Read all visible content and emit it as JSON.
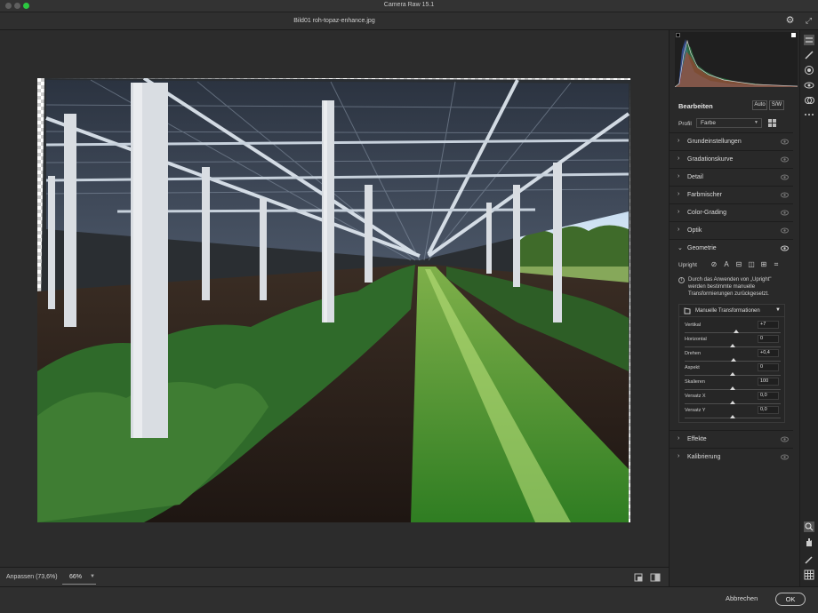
{
  "window": {
    "app_title": "Camera Raw 15.1",
    "file_name": "Bild01 roh-topaz-enhance.jpg"
  },
  "header": {
    "settings_icon": "gear-icon",
    "fullscreen_icon": "expand-icon"
  },
  "status": {
    "fit_label": "Anpassen (73,6%)",
    "zoom_value": "66%"
  },
  "footer": {
    "cancel_label": "Abbrechen",
    "ok_label": "OK"
  },
  "panel": {
    "title": "Bearbeiten",
    "auto_label": "Auto",
    "sw_label": "S/W",
    "profile_label": "Profil",
    "profile_value": "Farbe",
    "sections": [
      {
        "label": "Grundeinstellungen",
        "expanded": false
      },
      {
        "label": "Gradationskurve",
        "expanded": false
      },
      {
        "label": "Detail",
        "expanded": false
      },
      {
        "label": "Farbmischer",
        "expanded": false
      },
      {
        "label": "Color-Grading",
        "expanded": false
      },
      {
        "label": "Optik",
        "expanded": false
      },
      {
        "label": "Geometrie",
        "expanded": true
      },
      {
        "label": "Effekte",
        "expanded": false
      },
      {
        "label": "Kalibrierung",
        "expanded": false
      }
    ],
    "geometry": {
      "upright_label": "Upright",
      "info_text": "Durch das Anwenden von „Upright\" werden bestimmte manuelle Transformierungen zurückgesetzt.",
      "manual_title": "Manuelle Transformationen",
      "sliders": [
        {
          "label": "Vertikal",
          "value": "+7",
          "fraction": 0.535
        },
        {
          "label": "Horizontal",
          "value": "0",
          "fraction": 0.5
        },
        {
          "label": "Drehen",
          "value": "+0,4",
          "fraction": 0.505
        },
        {
          "label": "Aspekt",
          "value": "0",
          "fraction": 0.5
        },
        {
          "label": "Skalieren",
          "value": "100",
          "fraction": 0.5
        },
        {
          "label": "Versatz X",
          "value": "0,0",
          "fraction": 0.5
        },
        {
          "label": "Versatz Y",
          "value": "0,0",
          "fraction": 0.5
        }
      ]
    }
  },
  "colors": {
    "accent": "#2bc840",
    "histogram_red": "#c0392b",
    "histogram_green": "#3aa35a",
    "histogram_blue": "#3f6bd8"
  }
}
